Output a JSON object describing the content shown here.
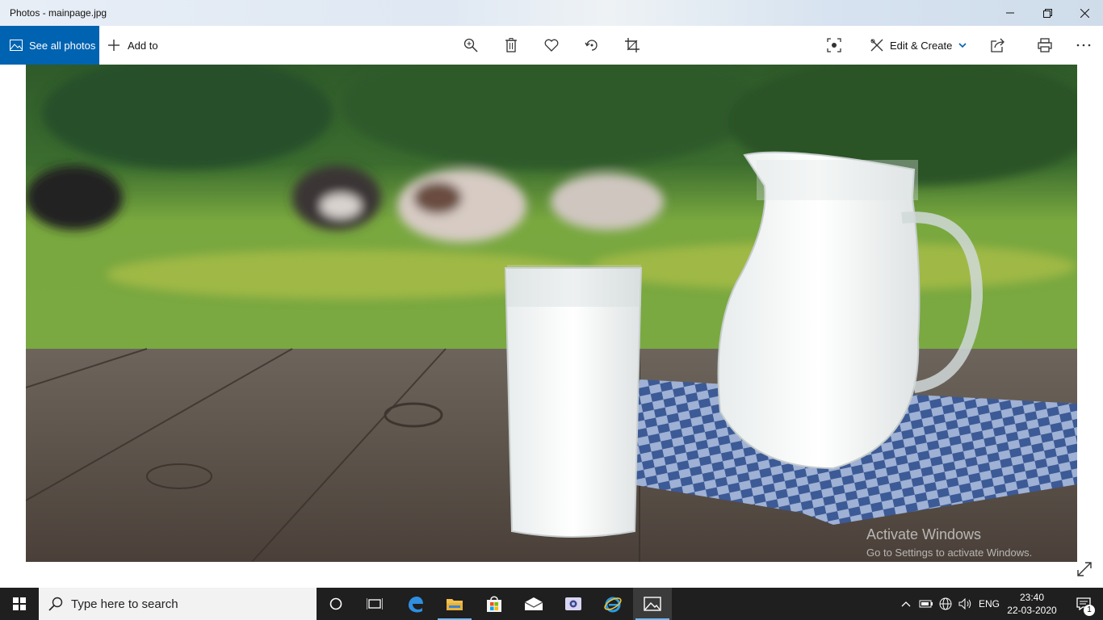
{
  "window": {
    "title": "Photos - mainpage.jpg",
    "controls": [
      "minimize-icon",
      "restore-icon",
      "close-icon"
    ]
  },
  "toolbar": {
    "see_all_label": "See all photos",
    "add_to_label": "Add to",
    "icons": [
      "zoom-icon",
      "delete-icon",
      "favorite-icon",
      "rotate-icon",
      "crop-icon",
      "enhance-icon"
    ],
    "edit_create_label": "Edit & Create",
    "right_icons": [
      "share-icon",
      "print-icon",
      "more-icon"
    ],
    "accent_color": "#0063b1"
  },
  "viewer": {
    "watermark_line1": "Activate Windows",
    "watermark_line2": "Go to Settings to activate Windows."
  },
  "taskbar": {
    "search_placeholder": "Type here to search",
    "apps": [
      "cortana-icon",
      "task-view-icon",
      "edge-icon",
      "file-explorer-icon",
      "store-icon",
      "mail-icon",
      "app-icon",
      "internet-explorer-icon",
      "photos-icon"
    ],
    "active_app": "photos-icon",
    "language": "ENG",
    "time": "23:40",
    "date": "22-03-2020",
    "notification_count": "1"
  }
}
